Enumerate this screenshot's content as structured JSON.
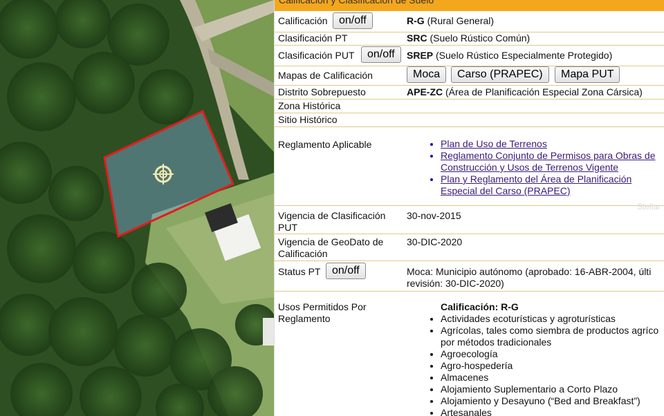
{
  "map": {
    "marker_icon": "crosshair-target-icon",
    "parcel_outline_color": "#e01e1e",
    "parcel_fill_color": "#7aa6d6"
  },
  "section_title": "Calificación y Clasificación de Suelo",
  "calificacion": {
    "label": "Calificación",
    "toggle": "on/off",
    "code": "R-G",
    "desc": "(Rural General)"
  },
  "clasificacion_pt": {
    "label": "Clasificación PT",
    "code": "SRC",
    "desc": "(Suelo Rústico Común)"
  },
  "clasificacion_put": {
    "label": "Clasificación PUT",
    "toggle": "on/off",
    "code": "SREP",
    "desc": "(Suelo Rústico Especialmente Protegido)"
  },
  "mapas": {
    "label": "Mapas de Calificación",
    "buttons": [
      "Moca",
      "Carso (PRAPEC)",
      "Mapa PUT"
    ]
  },
  "distrito": {
    "label": "Distrito Sobrepuesto",
    "code": "APE-ZC",
    "desc": "(Área de Planificación Especial Zona Cársica)"
  },
  "zona_historica": {
    "label": "Zona Histórica"
  },
  "sitio_historico": {
    "label": "Sitio Histórico"
  },
  "reglamento": {
    "label": "Reglamento Aplicable",
    "links": [
      "Plan de Uso de Terrenos",
      "Reglamento Conjunto de Permisos para Obras de Construcción y Usos de Terrenos Vigente",
      "Plan y Reglamento del Área de Planificación Especial del Carso (PRAPEC)"
    ]
  },
  "vigencia_put": {
    "label": "Vigencia de Clasificación PUT",
    "value": "30-nov-2015"
  },
  "vigencia_geodato": {
    "label": "Vigencia de GeoDato de Calificación",
    "value": "30-DIC-2020"
  },
  "status_pt": {
    "label": "Status PT",
    "toggle": "on/off",
    "value_line1": "Moca: Municipio autónomo (aprobado: 16-ABR-2004, últi",
    "value_line2": "revisión: 30-DIC-2020)"
  },
  "usos": {
    "label": "Usos Permitidos Por Reglamento",
    "heading": "Calificación: R-G",
    "items": [
      "Actividades ecoturísticas y agroturísticas",
      "Agrícolas, tales como siembra de productos agríco",
      "por métodos tradicionales",
      "Agroecología",
      "Agro-hospedería",
      "Almacenes",
      "Alojamiento Suplementario a Corto Plazo",
      "Alojamiento y Desayuno (“Bed and Breakfast”)",
      "Artesanales"
    ]
  },
  "watermark": "Stellar"
}
